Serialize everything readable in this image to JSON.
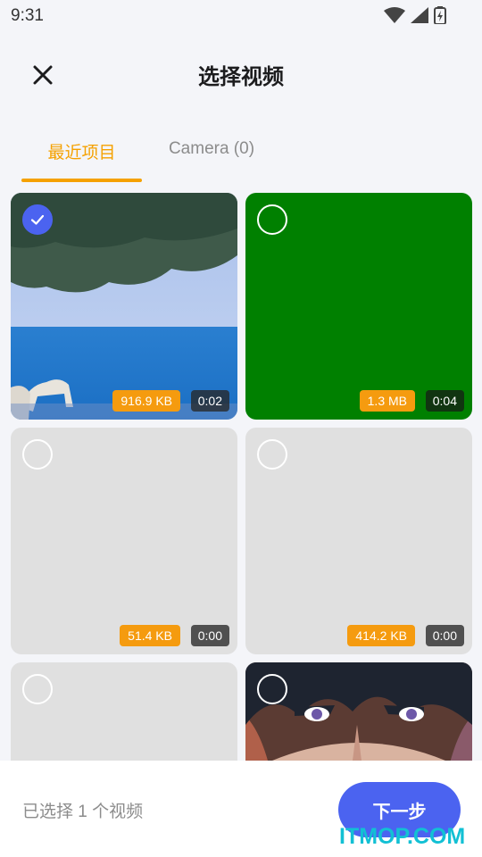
{
  "status_bar": {
    "time": "9:31",
    "icons": [
      "wifi-icon",
      "cellular-signal-icon",
      "battery-charging-icon"
    ]
  },
  "header": {
    "title": "选择视频",
    "close_icon": "close-icon"
  },
  "tabs": [
    {
      "label": "最近项目",
      "active": true
    },
    {
      "label": "Camera (0)",
      "active": false
    }
  ],
  "colors": {
    "accent_orange": "#f5a100",
    "primary_blue": "#4b63f0",
    "size_badge": "#f59b0f",
    "green_tile": "#008000"
  },
  "videos": [
    {
      "size": "916.9 KB",
      "duration": "0:02",
      "selected": true,
      "thumbnail": "seaside-tree-goat"
    },
    {
      "size": "1.3 MB",
      "duration": "0:04",
      "selected": false,
      "thumbnail": "solid-green"
    },
    {
      "size": "51.4 KB",
      "duration": "0:00",
      "selected": false,
      "thumbnail": "blank-gray"
    },
    {
      "size": "414.2 KB",
      "duration": "0:00",
      "selected": false,
      "thumbnail": "blank-gray"
    },
    {
      "size": "",
      "duration": "",
      "selected": false,
      "thumbnail": "blank-gray"
    },
    {
      "size": "",
      "duration": "",
      "selected": false,
      "thumbnail": "anime-character-face"
    }
  ],
  "bottom_bar": {
    "selection_text": "已选择 1 个视频",
    "next_label": "下一步"
  },
  "watermark": "ITMOP.COM"
}
